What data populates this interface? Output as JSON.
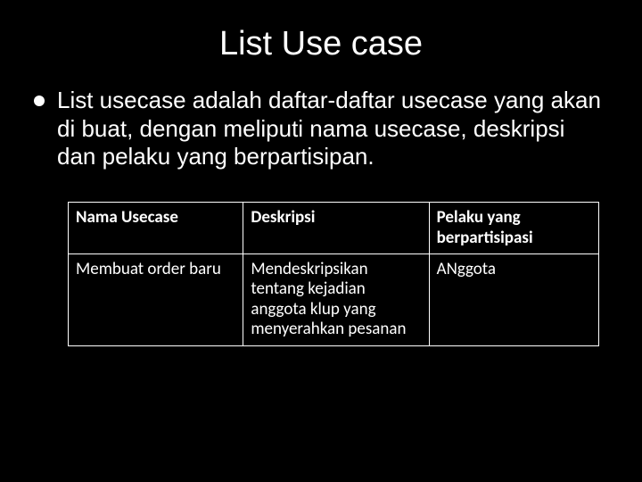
{
  "title": "List Use case",
  "body": "List usecase adalah daftar-daftar usecase yang akan di buat, dengan meliputi nama usecase, deskripsi dan pelaku yang berpartisipan.",
  "table": {
    "headers": {
      "col1": "Nama Usecase",
      "col2": "Deskripsi",
      "col3": "Pelaku yang berpartisipasi"
    },
    "row1": {
      "col1": "Membuat order baru",
      "col2": "Mendeskripsikan tentang kejadian anggota klup yang menyerahkan pesanan",
      "col3": "ANggota"
    }
  }
}
